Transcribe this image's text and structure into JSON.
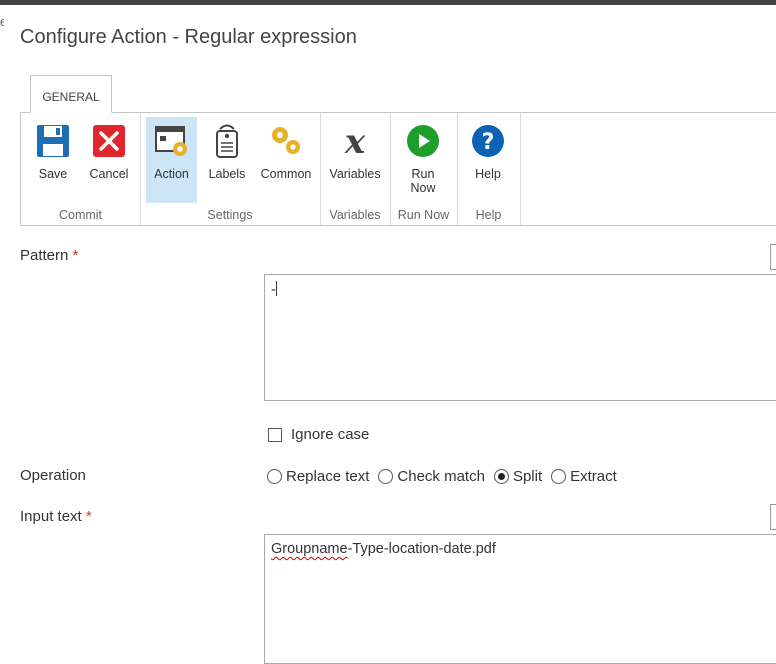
{
  "dialog": {
    "title": "Configure Action - Regular expression"
  },
  "ribbon": {
    "tab": "GENERAL",
    "groups": {
      "commit": {
        "label": "Commit",
        "save": "Save",
        "cancel": "Cancel"
      },
      "settings": {
        "label": "Settings",
        "action": "Action",
        "labels": "Labels",
        "common": "Common"
      },
      "variables": {
        "label": "Variables",
        "variables": "Variables"
      },
      "run_now": {
        "label": "Run Now",
        "run_line1": "Run",
        "run_line2": "Now"
      },
      "help": {
        "label": "Help",
        "help": "Help"
      }
    },
    "colors": {
      "save": "#1e6fb5",
      "cancel": "#e3262e",
      "gear": "#e8b12a",
      "run": "#1e9e2b",
      "help": "#0c63b6",
      "active": "#cde6f7"
    }
  },
  "form": {
    "pattern": {
      "label": "Pattern",
      "required": "*",
      "value": "-"
    },
    "ignore_case": {
      "label": "Ignore case",
      "checked": false
    },
    "operation": {
      "label": "Operation",
      "options": [
        "Replace text",
        "Check match",
        "Split",
        "Extract"
      ],
      "selected": "Split"
    },
    "input_text": {
      "label": "Input text",
      "required": "*",
      "value_part1": "Groupname",
      "value_part2": "-Type-location-date.pdf"
    }
  }
}
